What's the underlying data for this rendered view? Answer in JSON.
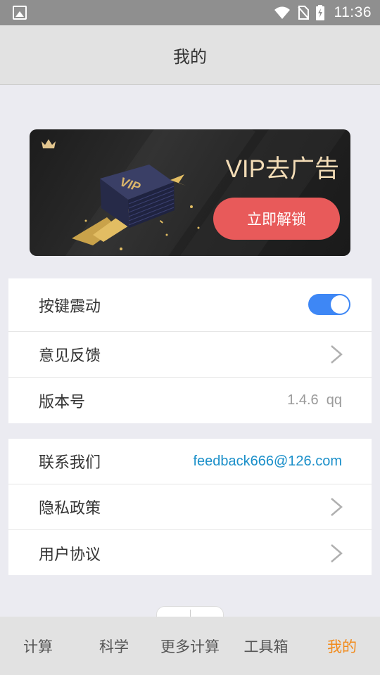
{
  "status_bar": {
    "time": "11:36",
    "icons": [
      "gallery-icon",
      "wifi-icon",
      "no-sim-icon",
      "battery-charging-icon"
    ]
  },
  "header": {
    "title": "我的"
  },
  "vip_banner": {
    "title": "VIP去广告",
    "button_label": "立即解锁",
    "art_text": "VIP",
    "accent_color": "#e85a5a",
    "title_color": "#f3dcb6"
  },
  "settings_group_1": {
    "vibration_label": "按键震动",
    "vibration_enabled": true,
    "feedback_label": "意见反馈",
    "version_label": "版本号",
    "version_value": "1.4.6  qq"
  },
  "settings_group_2": {
    "contact_label": "联系我们",
    "contact_email": "feedback666@126.com",
    "privacy_label": "隐私政策",
    "agreement_label": "用户协议"
  },
  "tabs": [
    {
      "label": "计算",
      "active": false
    },
    {
      "label": "科学",
      "active": false
    },
    {
      "label": "更多计算",
      "active": false
    },
    {
      "label": "工具箱",
      "active": false
    },
    {
      "label": "我的",
      "active": true
    }
  ],
  "colors": {
    "toggle_on": "#3e87f5",
    "tab_active": "#f28a1a",
    "email_link": "#1a8fc9"
  }
}
